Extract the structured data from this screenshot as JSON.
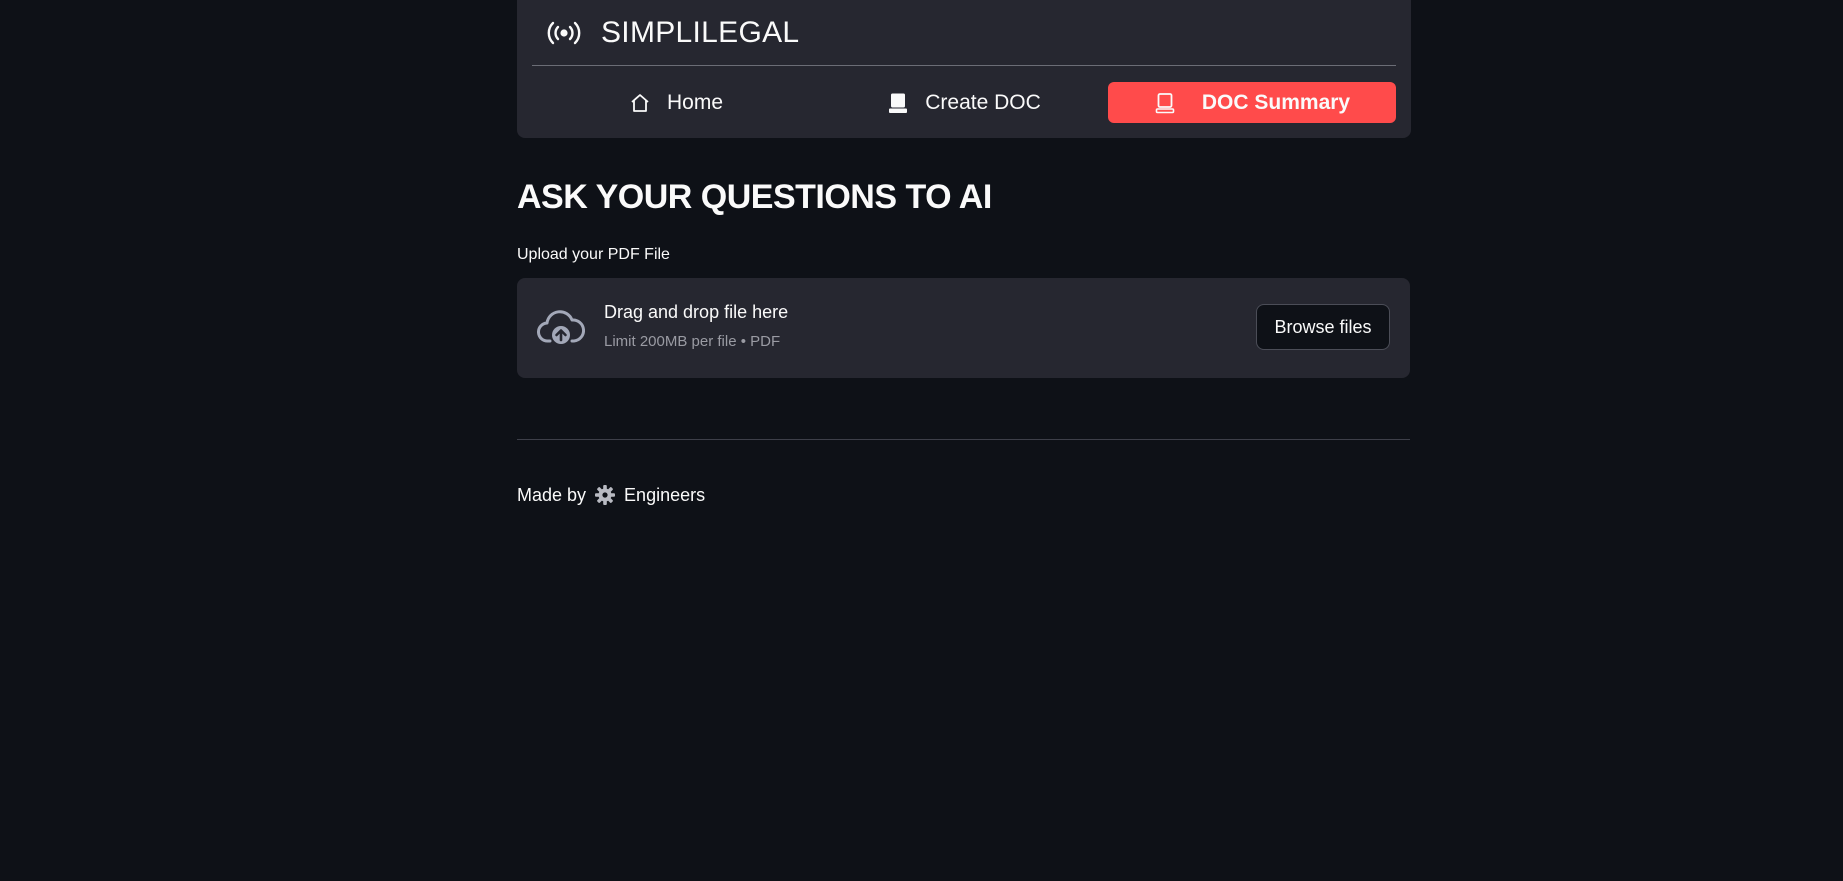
{
  "app": {
    "title": "SIMPLILEGAL",
    "brand_icon": "broadcast-icon"
  },
  "nav": {
    "items": [
      {
        "label": "Home",
        "icon": "house-icon",
        "active": false
      },
      {
        "label": "Create DOC",
        "icon": "tablet-icon",
        "active": false
      },
      {
        "label": "DOC Summary",
        "icon": "tablet-icon",
        "active": true
      }
    ],
    "active_color": "#ff4b4b"
  },
  "main": {
    "title": "ASK YOUR QUESTIONS TO AI",
    "uploader": {
      "label": "Upload your PDF File",
      "drop_text": "Drag and drop file here",
      "limit_text": "Limit 200MB per file • PDF",
      "browse_label": "Browse files",
      "icon": "cloud-upload-icon"
    }
  },
  "footer": {
    "prefix": "Made by",
    "icon": "gear-icon",
    "suffix": "Engineers"
  },
  "colors": {
    "background": "#0e1117",
    "card": "#262730",
    "accent": "#ff4b4b"
  }
}
